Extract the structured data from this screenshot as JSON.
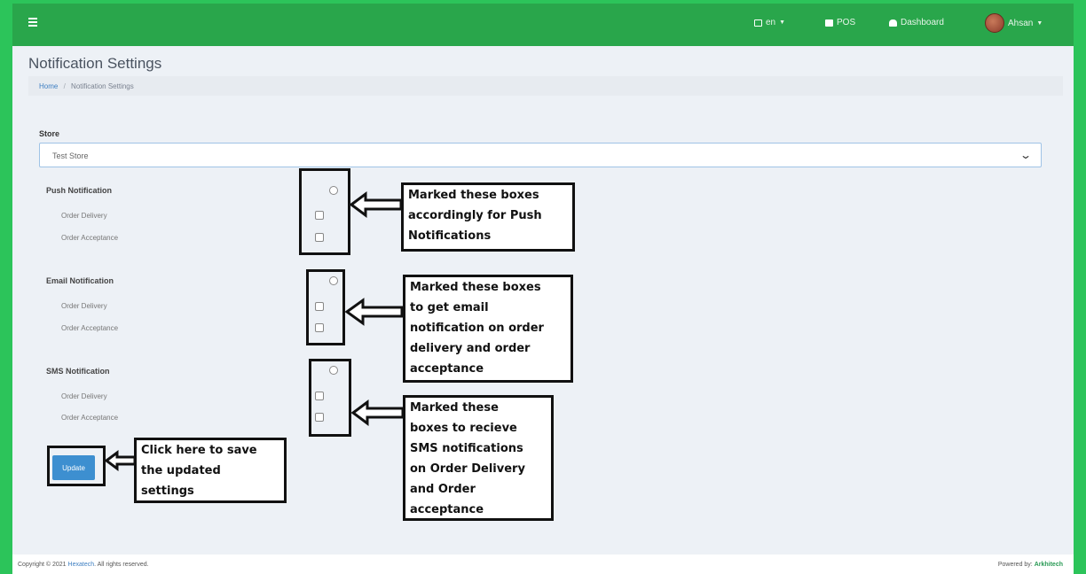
{
  "topbar": {
    "menu_icon": "hamburger-icon",
    "language": "en",
    "pos": "POS",
    "dashboard": "Dashboard",
    "user": "Ahsan",
    "colors": {
      "topbar": "#29a64b",
      "outer_border": "#2cc45a"
    }
  },
  "page": {
    "title": "Notification Settings",
    "breadcrumb_home": "Home",
    "breadcrumb_current": "Notification Settings"
  },
  "store": {
    "label": "Store",
    "selected": "Test Store"
  },
  "sections": {
    "push": {
      "title": "Push Notification",
      "order_delivery": "Order Delivery",
      "order_acceptance": "Order Acceptance"
    },
    "email": {
      "title": "Email Notification",
      "order_delivery": "Order Delivery",
      "order_acceptance": "Order Acceptance"
    },
    "sms": {
      "title": "SMS Notification",
      "order_delivery": "Order Delivery",
      "order_acceptance": "Order Acceptance"
    }
  },
  "update_button": "Update",
  "annotations": {
    "push": [
      "Marked these boxes",
      "accordingly for Push",
      "Notifications"
    ],
    "email": [
      "Marked these boxes",
      "to get email",
      "notification on order",
      "delivery and order",
      "acceptance"
    ],
    "sms": [
      "Marked these",
      "boxes to recieve",
      "SMS notifications",
      "on Order Delivery",
      "and Order",
      "acceptance"
    ],
    "update": [
      "Click here to save",
      "the updated",
      "settings"
    ]
  },
  "footer": {
    "copyright_prefix": "Copyright © 2021",
    "copyright_link": "Hexatech",
    "copyright_suffix": ". All rights reserved.",
    "powered_prefix": "Powered by:",
    "powered_brand": "Arkhitech"
  }
}
